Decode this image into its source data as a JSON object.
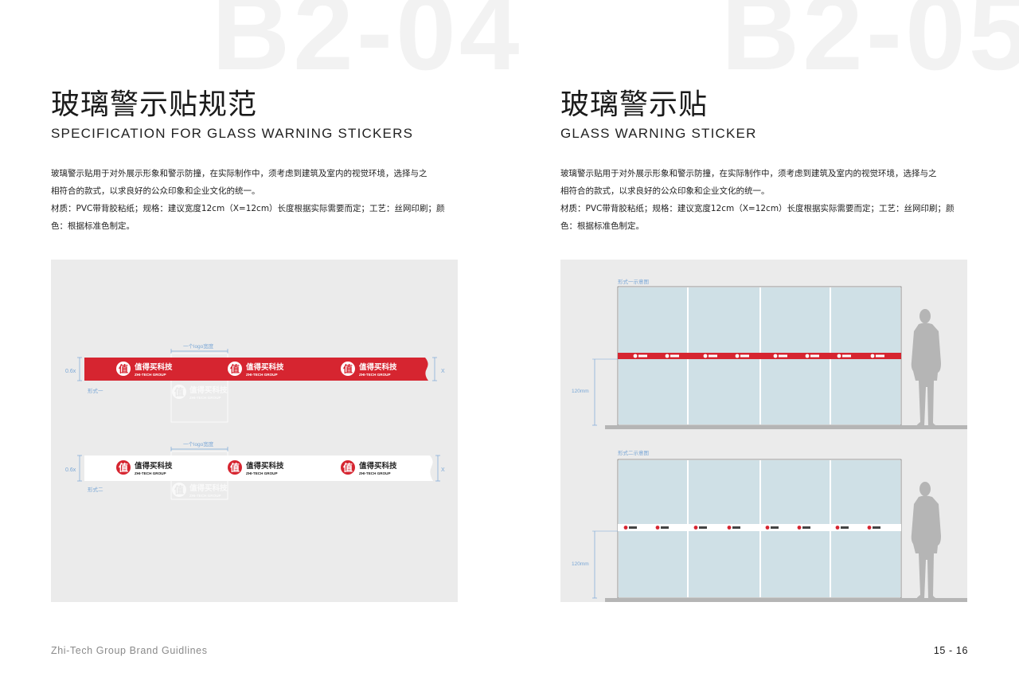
{
  "left": {
    "page_code": "B2-04",
    "title_cn": "玻璃警示贴规范",
    "title_en": "SPECIFICATION FOR GLASS WARNING STICKERS",
    "desc": [
      "玻璃警示贴用于对外展示形象和警示防撞，在实际制作中，须考虑到建筑及室内的视觉环境，选择与之",
      "相符合的款式，以求良好的公众印象和企业文化的统一。",
      "材质：PVC带背胶粘纸；规格：建议宽度12cm（X=12cm）长度根据实际需要而定；工艺：丝网印刷；颜",
      "色：根据标准色制定。"
    ],
    "diagram": {
      "logo_width_label": "一个logo宽度",
      "height_label": "0.6x",
      "x_label": "X",
      "style_one_label": "形式一",
      "style_two_label": "形式二"
    }
  },
  "right": {
    "page_code": "B2-05",
    "title_cn": "玻璃警示贴",
    "title_en": "GLASS WARNING STICKER",
    "desc": [
      "玻璃警示贴用于对外展示形象和警示防撞，在实际制作中，须考虑到建筑及室内的视觉环境，选择与之",
      "相符合的款式，以求良好的公众印象和企业文化的统一。",
      "材质：PVC带背胶粘纸；规格：建议宽度12cm（X=12cm）长度根据实际需要而定；工艺：丝网印刷；颜",
      "色：根据标准色制定。"
    ],
    "diagram": {
      "style_one_caption": "形式一示意图",
      "style_two_caption": "形式二示意图",
      "height_label": "120mm"
    }
  },
  "logo": {
    "mark": "值",
    "name_cn": "值得买科技",
    "name_en": "ZHI-TECH GROUP"
  },
  "footer": {
    "brand": "Zhi-Tech Group Brand Guidlines",
    "page_numbers": "15 - 16"
  },
  "colors": {
    "brand_red": "#d62530",
    "dimension_blue": "#7aa7d6",
    "glass": "#cfe0e6",
    "panel_gray": "#ebebeb",
    "person_gray": "#b5b5b5"
  }
}
